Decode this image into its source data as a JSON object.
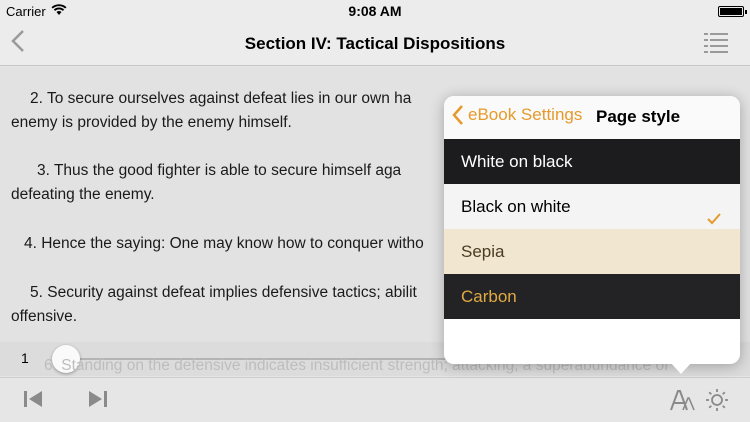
{
  "status": {
    "carrier": "Carrier",
    "time": "9:08 AM"
  },
  "nav": {
    "title": "Section IV: Tactical Dispositions"
  },
  "page": {
    "paragraphs": [
      "2. To secure ourselves against defeat lies in our own ha",
      "enemy is provided by the enemy himself.",
      "3. Thus the good fighter is able to secure himself aga",
      "defeating the enemy.",
      "4. Hence the saying: One may know how to conquer witho",
      "5. Security against defeat implies defensive tactics; abilit",
      "offensive."
    ],
    "ghost_line": "6. Standing on the defensive indicates insufficient strength; attacking, a superabundance of"
  },
  "slider": {
    "page_number": "1",
    "position": 0.0
  },
  "popover": {
    "back_label": "eBook Settings",
    "title": "Page style",
    "options": [
      {
        "label": "White on black",
        "bg": "#1c1c1e",
        "fg": "#ffffff",
        "selected": false
      },
      {
        "label": "Black on white",
        "bg": "#f4f4f4",
        "fg": "#000000",
        "selected": true
      },
      {
        "label": "Sepia",
        "bg": "#f1e6cf",
        "fg": "#4a3b24",
        "selected": false
      },
      {
        "label": "Carbon",
        "bg": "#232325",
        "fg": "#e0a943",
        "selected": false
      }
    ]
  },
  "colors": {
    "accent": "#e59a2b"
  },
  "icons": {
    "back": "chevron-left-icon",
    "toc": "list-icon",
    "prev": "skip-back-icon",
    "next": "skip-forward-icon",
    "font": "font-size-icon",
    "brightness": "sun-icon",
    "check": "checkmark-icon"
  }
}
